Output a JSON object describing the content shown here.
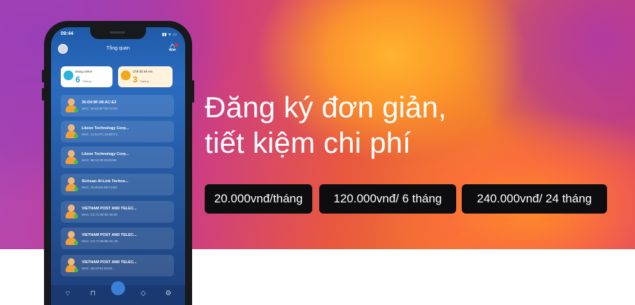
{
  "banner": {
    "headline_line1": "Đăng ký đơn giản,",
    "headline_line2": "tiết kiệm chi phí",
    "prices": [
      "20.000vnđ/tháng",
      "120.000vnđ/ 6 tháng",
      "240.000vnđ/ 24 tháng"
    ]
  },
  "phone": {
    "status_time": "09:44",
    "status_icons": "▮▮ ᯤ ▭",
    "app_title": "Tổng quan",
    "stats": [
      {
        "label": "Đang online",
        "value": "6",
        "unit": "Thiết bị"
      },
      {
        "label": "Chế độ trẻ em",
        "value": "3",
        "unit": "Thiết bị"
      }
    ],
    "devices": [
      {
        "name": "36:D4:9F:08:AC:E2",
        "mac": "MAC: 36:D4:9F:08:AC:E2"
      },
      {
        "name": "Liteon Technology Corp...",
        "mac": "MAC: 14:5A:FC:16:8D:F1"
      },
      {
        "name": "Liteon Technology Corp...",
        "mac": "MAC: 9E:12:30:29:83:B0"
      },
      {
        "name": "Sichuan AI-Link Techno...",
        "mac": "MAC: 40:35:E6:D9:73:E0"
      },
      {
        "name": "VIETNAM POST AND TELEC...",
        "mac": "MAC: CC:71:90:6E:30:48"
      },
      {
        "name": "VIETNAM POST AND TELEC...",
        "mac": "MAC: CC:71:90:6E:2C:40"
      },
      {
        "name": "VIETNAM POST AND TELEC...",
        "mac": "MAC: 4D:10:91:52:62:..."
      }
    ],
    "tabs": [
      "wifi-icon",
      "lock-icon",
      "home-icon",
      "shield-icon",
      "settings-icon"
    ]
  },
  "colors": {
    "price_bg": "#0d0d0f",
    "accent_blue": "#1e9fd0",
    "accent_orange": "#e09a10"
  }
}
